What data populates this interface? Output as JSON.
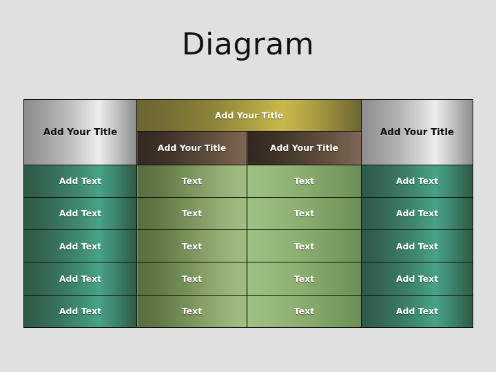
{
  "slide": {
    "title": "Diagram",
    "background_color": "#e0e0e0"
  },
  "table": {
    "header": {
      "col1_merged_label": "Add Your Title",
      "span_label": "Add Your Title",
      "sub_labels": [
        "Add Your Title",
        "Add Your Title"
      ],
      "col4_merged_label": "Add Your Title"
    },
    "rows": [
      {
        "c1": "Add Text",
        "c2": "Text",
        "c3": "Text",
        "c4": "Add Text"
      },
      {
        "c1": "Add Text",
        "c2": "Text",
        "c3": "Text",
        "c4": "Add Text"
      },
      {
        "c1": "Add Text",
        "c2": "Text",
        "c3": "Text",
        "c4": "Add Text"
      },
      {
        "c1": "Add Text",
        "c2": "Text",
        "c3": "Text",
        "c4": "Add Text"
      },
      {
        "c1": "Add Text",
        "c2": "Text",
        "c3": "Text",
        "c4": "Add Text"
      }
    ]
  },
  "colors": {
    "silver_light": "#ededed",
    "silver_dark": "#8d8d8d",
    "olive_light": "#c9b94c",
    "olive_dark": "#6b6531",
    "brown_light": "#806856",
    "brown_dark": "#322820",
    "teal_light": "#47a386",
    "teal_dark": "#2e5a47",
    "green_light": "#a0be83",
    "green_dark": "#576e3f",
    "border": "#0a0a0a",
    "title_text": "#121212"
  }
}
